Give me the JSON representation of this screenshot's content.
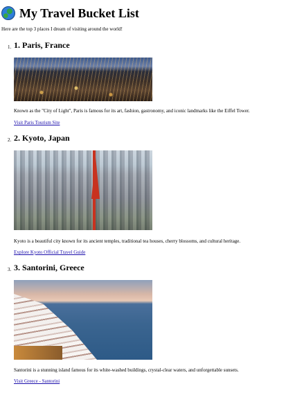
{
  "header": {
    "title": "My Travel Bucket List",
    "globe_icon": "globe-icon"
  },
  "intro": "Here are the top 3 places I dream of visiting around the world!",
  "places": [
    {
      "number": "1.",
      "heading": "1. Paris, France",
      "description": "Known as the \"City of Light\", Paris is famous for its art, fashion, gastronomy, and iconic landmarks like the Eiffel Tower.",
      "link_text": "Visit Paris Tourism Site"
    },
    {
      "number": "2.",
      "heading": "2. Kyoto, Japan",
      "description": "Kyoto is a beautiful city known for its ancient temples, traditional tea houses, cherry blossoms, and cultural heritage.",
      "link_text": "Explore Kyoto Official Travel Guide"
    },
    {
      "number": "3.",
      "heading": "3. Santorini, Greece",
      "description": "Santorini is a stunning island famous for its white-washed buildings, crystal-clear waters, and unforgettable sunsets.",
      "link_text": "Visit Greece - Santorini"
    }
  ],
  "colors": {
    "link": "#1a0dab",
    "text": "#000000",
    "background": "#ffffff"
  }
}
